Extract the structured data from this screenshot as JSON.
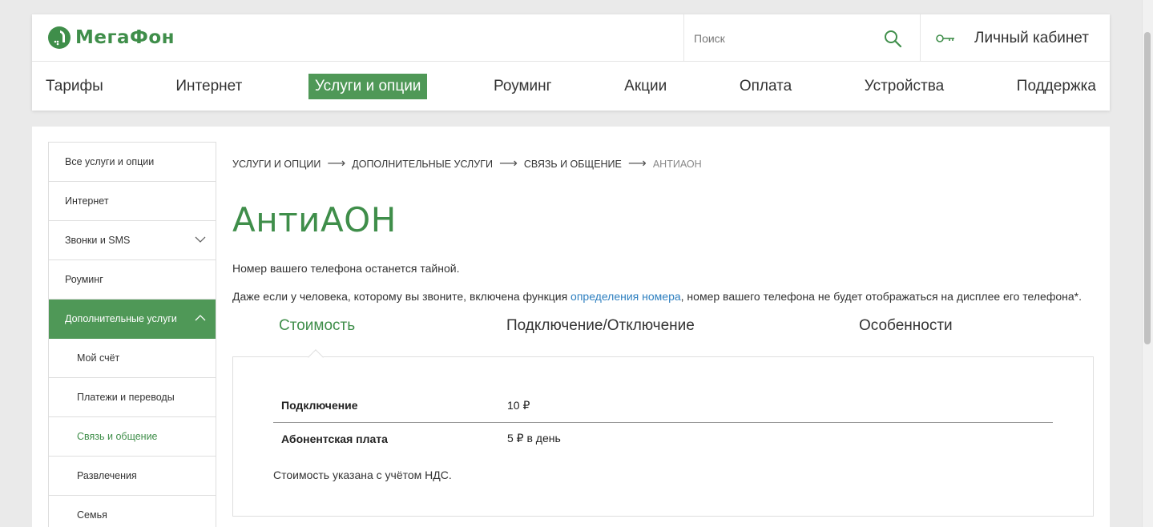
{
  "brand": {
    "logo_text": "МегаФон",
    "color": "#3f8e4a",
    "accent": "#4f9857"
  },
  "header": {
    "search_placeholder": "Поиск",
    "cabinet_label": "Личный кабинет"
  },
  "nav": [
    {
      "label": "Тарифы",
      "active": false
    },
    {
      "label": "Интернет",
      "active": false
    },
    {
      "label": "Услуги и опции",
      "active": true
    },
    {
      "label": "Роуминг",
      "active": false
    },
    {
      "label": "Акции",
      "active": false
    },
    {
      "label": "Оплата",
      "active": false
    },
    {
      "label": "Устройства",
      "active": false
    },
    {
      "label": "Поддержка",
      "active": false
    }
  ],
  "sidebar": {
    "items": [
      {
        "label": "Все услуги и опции"
      },
      {
        "label": "Интернет"
      },
      {
        "label": "Звонки и SMS"
      },
      {
        "label": "Роуминг"
      },
      {
        "label": "Дополнительные услуги"
      },
      {
        "label": "Мой счёт"
      },
      {
        "label": "Платежи и переводы"
      },
      {
        "label": "Связь и общение"
      },
      {
        "label": "Развлечения"
      },
      {
        "label": "Семья"
      }
    ]
  },
  "breadcrumb": [
    "УСЛУГИ И ОПЦИИ",
    "ДОПОЛНИТЕЛЬНЫЕ УСЛУГИ",
    "СВЯЗЬ И ОБЩЕНИЕ",
    "АНТИАОН"
  ],
  "page": {
    "title": "АнтиАОН",
    "lead1": "Номер вашего телефона останется тайной.",
    "lead2_before": "Даже если у человека, которому вы звоните, включена функция ",
    "lead2_link": "определения номера",
    "lead2_after": ", номер вашего телефона не будет отображаться на дисплее его телефона*."
  },
  "tabs": [
    {
      "label": "Стоимость",
      "active": true
    },
    {
      "label": "Подключение/Отключение",
      "active": false
    },
    {
      "label": "Особенности",
      "active": false
    }
  ],
  "pricing": {
    "rows": [
      {
        "name": "Подключение",
        "value": "10 ₽"
      },
      {
        "name": "Абонентская плата",
        "value": "5 ₽ в день"
      }
    ],
    "note": "Стоимость указана с учётом НДС."
  }
}
